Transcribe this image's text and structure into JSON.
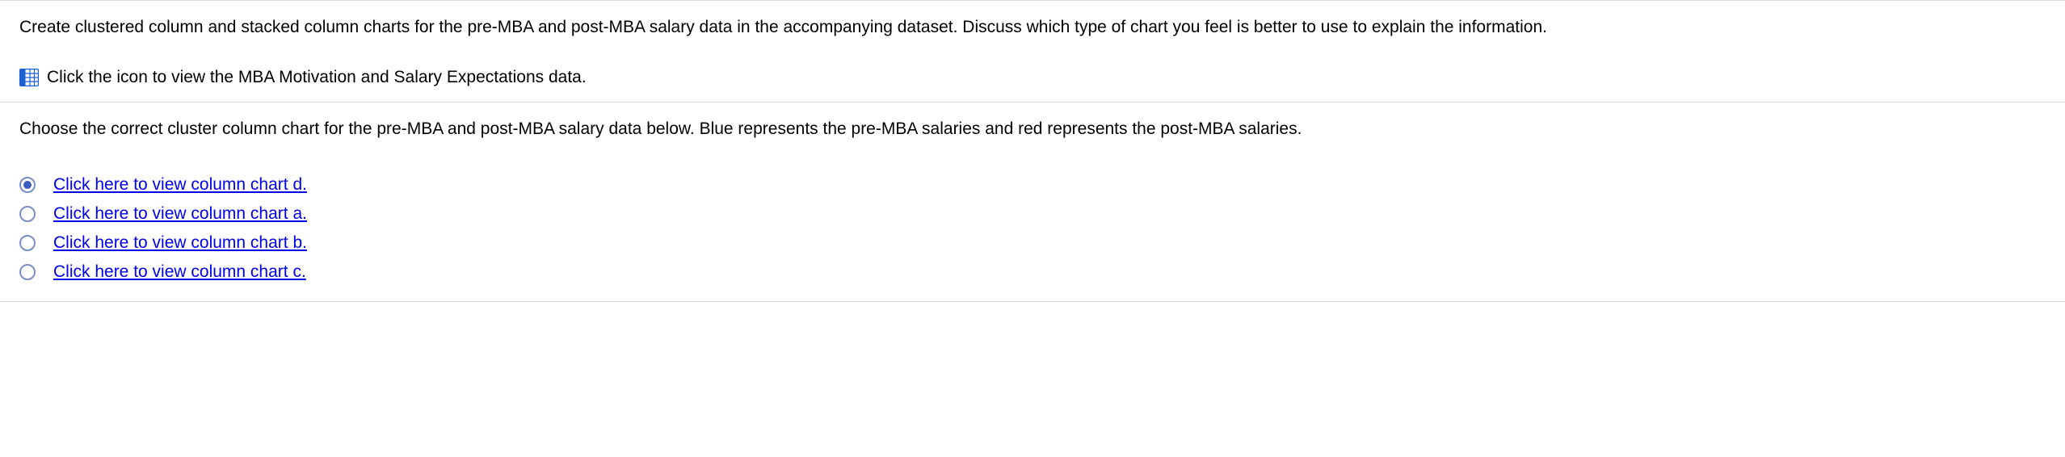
{
  "intro": "Create clustered column and stacked column charts for the pre-MBA and post-MBA salary data in the accompanying dataset. Discuss which type of chart you feel is better to use to explain the information.",
  "dataLink": "Click the icon to view the MBA Motivation and Salary Expectations data.",
  "question": "Choose the correct cluster column chart for the pre-MBA and post-MBA salary data below. Blue represents the pre-MBA salaries and red represents the post-MBA salaries.",
  "options": [
    {
      "label": "Click here to view column chart d.",
      "selected": true
    },
    {
      "label": "Click here to view column chart a.",
      "selected": false
    },
    {
      "label": "Click here to view column chart b.",
      "selected": false
    },
    {
      "label": "Click here to view column chart c.",
      "selected": false
    }
  ]
}
